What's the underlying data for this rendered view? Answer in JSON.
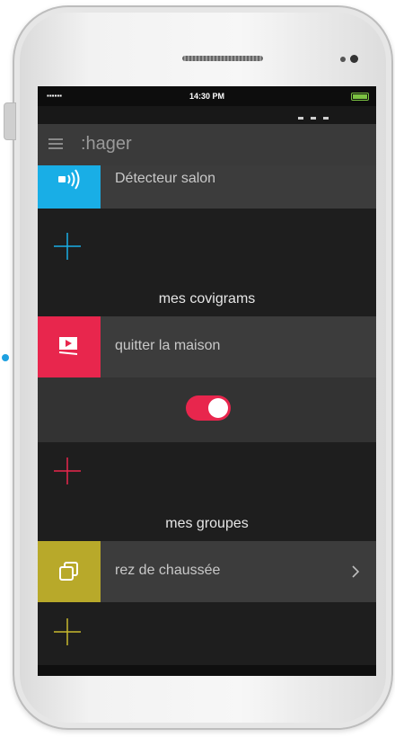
{
  "status_bar": {
    "signal": "▪▪▪▪▪▪",
    "time": "14:30 PM"
  },
  "header": {
    "logo": ":hager"
  },
  "detector": {
    "label": "Détecteur salon",
    "tile_color": "#19aee6"
  },
  "covigrams": {
    "title": "mes covigrams",
    "item_label": "quitter la maison",
    "tile_color": "#e8264d",
    "toggle_on": true,
    "accent": "#e8264d"
  },
  "groups": {
    "title": "mes groupes",
    "item_label": "rez de chaussée",
    "tile_color": "#b8a92a",
    "accent": "#c7b82e"
  },
  "icons": {
    "menu": "hamburger-menu-icon",
    "detector": "wifi-signal-icon",
    "covigram": "play-screen-icon",
    "group": "stacked-squares-icon",
    "add": "plus-icon",
    "chevron": "chevron-right-icon"
  }
}
